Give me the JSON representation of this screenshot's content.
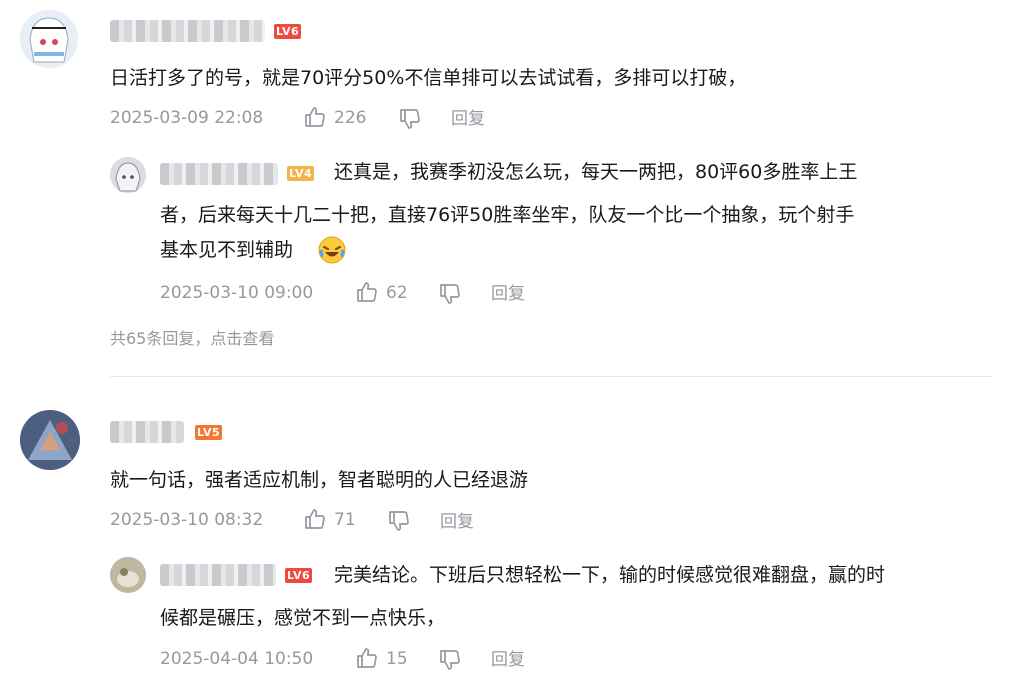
{
  "comments": [
    {
      "level": "LV6",
      "text": "日活打多了的号，就是70评分50%不信单排可以去试试看，多排可以打破，",
      "time": "2025-03-09 22:08",
      "likes": "226",
      "reply_label": "回复",
      "reply": {
        "level": "LV4",
        "text_line1": "还真是，我赛季初没怎么玩，每天一两把，80评60多胜率上王",
        "text_line2": "者，后来每天十几二十把，直接76评50胜率坐牢，队友一个比一个抽象，玩个射手",
        "text_line3": "基本见不到辅助",
        "time": "2025-03-10 09:00",
        "likes": "62",
        "reply_label": "回复"
      },
      "more_replies": "共65条回复，点击查看"
    },
    {
      "level": "LV5",
      "text": "就一句话，强者适应机制，智者聪明的人已经退游",
      "time": "2025-03-10 08:32",
      "likes": "71",
      "reply_label": "回复",
      "reply": {
        "level": "LV6",
        "text_line1": "完美结论。下班后只想轻松一下，输的时候感觉很难翻盘，赢的时",
        "text_line2": "候都是碾压，感觉不到一点快乐，",
        "time": "2025-04-04 10:50",
        "likes": "15",
        "reply_label": "回复"
      }
    }
  ],
  "icons": {
    "like": "thumbs-up-icon",
    "dislike": "thumbs-down-icon",
    "emoji": "laughing-crying-emoji-icon"
  }
}
